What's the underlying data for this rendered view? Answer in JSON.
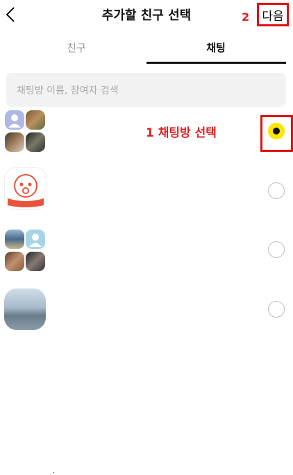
{
  "header": {
    "title": "추가할 친구 선택",
    "next_label": "다음",
    "step2_label": "2"
  },
  "tabs": [
    {
      "label": "친구"
    },
    {
      "label": "채팅"
    }
  ],
  "search": {
    "placeholder": "채팅방 이름, 참여자 검색"
  },
  "annotation": {
    "step1_label": "1  채팅방 선택"
  },
  "rows": [
    {
      "name": ".",
      "selected": true
    },
    {
      "name": "",
      "selected": false
    },
    {
      "name": ".",
      "selected": false
    },
    {
      "name": "",
      "selected": false
    }
  ],
  "colors": {
    "accent_yellow": "#ffe400",
    "annotation_red": "#e02020"
  }
}
